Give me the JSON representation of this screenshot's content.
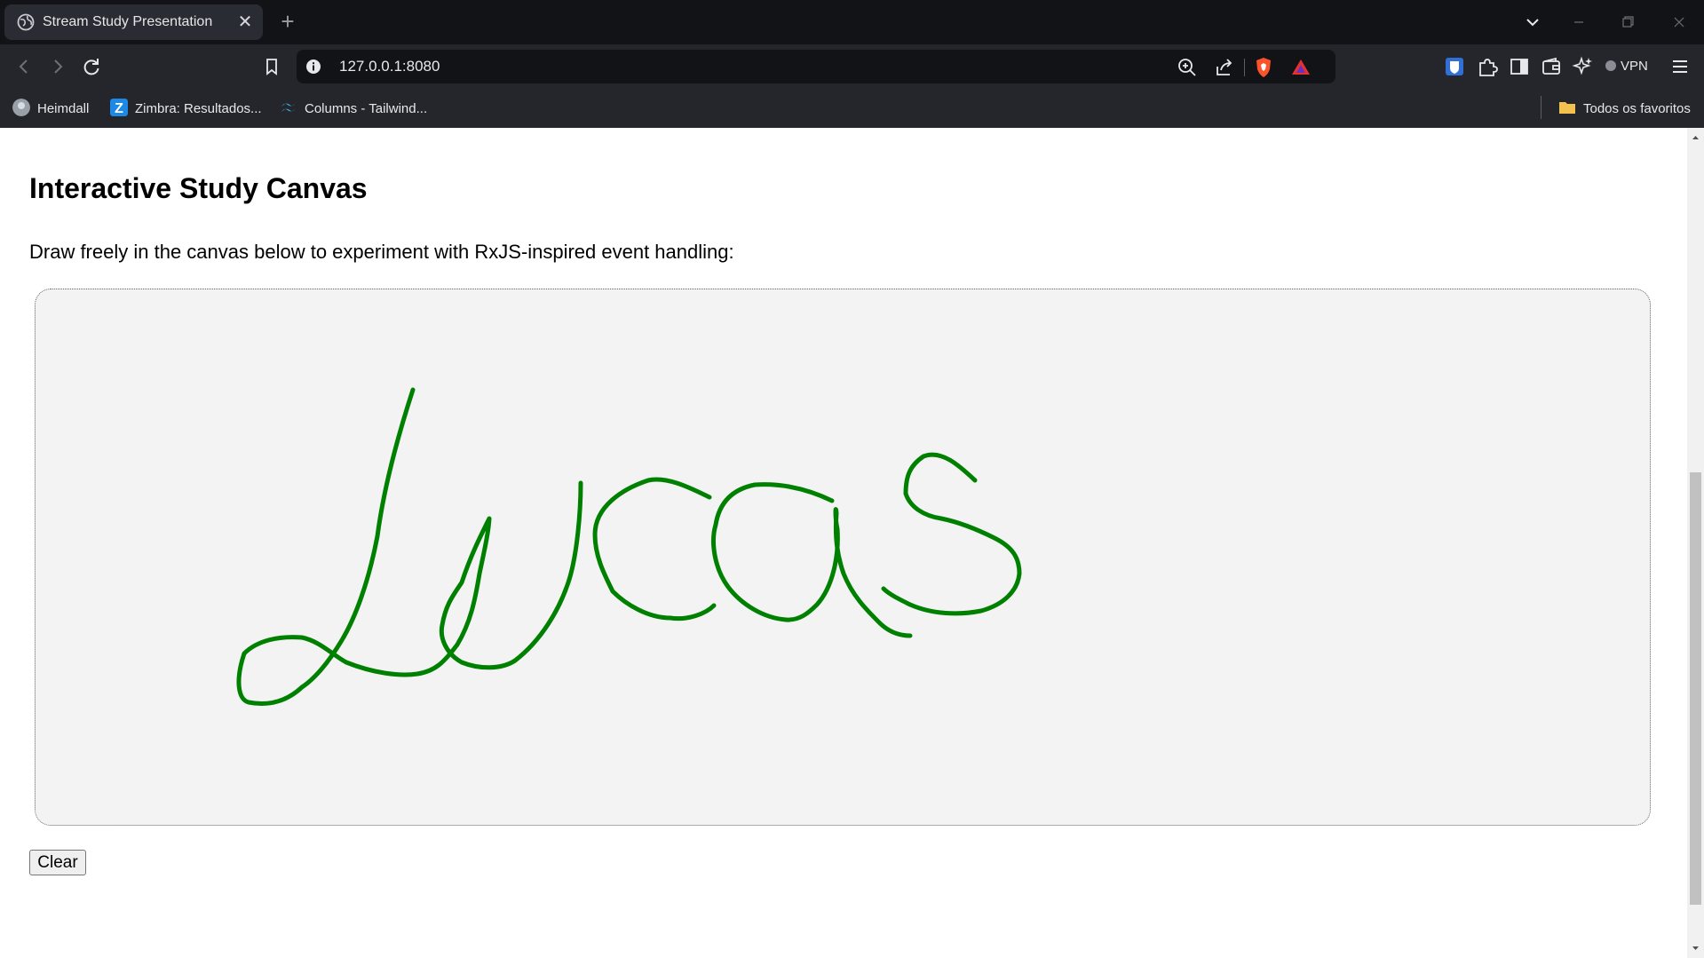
{
  "browser": {
    "tab": {
      "title": "Stream Study Presentation",
      "icon": "globe-icon"
    },
    "address": {
      "url": "127.0.0.1:8080"
    },
    "vpn_label": "VPN",
    "bookmarks": [
      {
        "label": "Heimdall",
        "icon": "heimdall-icon"
      },
      {
        "label": "Zimbra: Resultados...",
        "icon": "zimbra-icon"
      },
      {
        "label": "Columns - Tailwind...",
        "icon": "tailwind-icon"
      }
    ],
    "all_bookmarks_label": "Todos os favoritos"
  },
  "page": {
    "heading": "Interactive Study Canvas",
    "description": "Draw freely in the canvas below to experiment with RxJS-inspired event handling:",
    "clear_label": "Clear"
  },
  "colors": {
    "stroke": "#008000",
    "canvas_bg": "#f3f3f3",
    "chrome_bg": "#25262b",
    "titlebar_bg": "#121316"
  }
}
